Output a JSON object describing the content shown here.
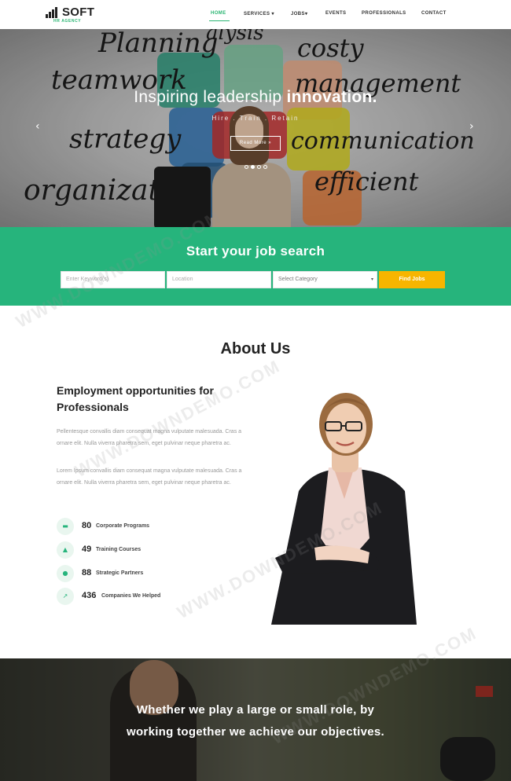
{
  "brand": {
    "name": "SOFT",
    "tagline": "HR AGENCY"
  },
  "nav": [
    {
      "label": "HOME",
      "active": true
    },
    {
      "label": "SERVICES ▾",
      "active": false
    },
    {
      "label": "JOBS▾",
      "active": false
    },
    {
      "label": "EVENTS",
      "active": false
    },
    {
      "label": "PROFESSIONALS",
      "active": false
    },
    {
      "label": "CONTACT",
      "active": false
    }
  ],
  "hero": {
    "title_light": "Inspiring leadership ",
    "title_bold": "innovation.",
    "subtitle": "Hire . Train . Retain",
    "button": "Read More »",
    "prev_icon": "chevron-left-icon",
    "next_icon": "chevron-right-icon",
    "background_words": [
      "Planning",
      "alysis",
      "costy",
      "teamwork",
      "management",
      "strategy",
      "communication",
      "organizat",
      "efficient"
    ]
  },
  "search": {
    "title": "Start your job search",
    "keyword_placeholder": "Enter Keyword(s)",
    "location_placeholder": "Location",
    "category_selected": "Select Category",
    "button": "Find Jobs",
    "background": "#26b47c",
    "button_color": "#f7b500"
  },
  "about": {
    "title": "About Us",
    "heading": "Employment opportunities for Professionals",
    "paragraphs": [
      "Pellentesque convallis diam consequat magna vulputate malesuada. Cras a ornare elit. Nulla viverra pharetra sem, eget pulvinar neque pharetra ac.",
      "Lorem Ipsum convallis diam consequat magna vulputate malesuada. Cras a ornare elit. Nulla viverra pharetra sem, eget pulvinar neque pharetra ac."
    ],
    "stats": [
      {
        "icon": "briefcase-icon",
        "glyph": "▬",
        "number": "80",
        "label": "Corporate Programs"
      },
      {
        "icon": "graduation-cap-icon",
        "glyph": "▲",
        "number": "49",
        "label": "Training Courses"
      },
      {
        "icon": "user-icon",
        "glyph": "●",
        "number": "88",
        "label": "Strategic Partners"
      },
      {
        "icon": "chart-line-icon",
        "glyph": "↗",
        "number": "436",
        "label": "Companies We Helped"
      }
    ]
  },
  "quote": {
    "line1": "Whether we play a large or small role, by",
    "line2": "working together we achieve our objectives."
  },
  "watermark": "WWW.DOWNDEMO.COM"
}
